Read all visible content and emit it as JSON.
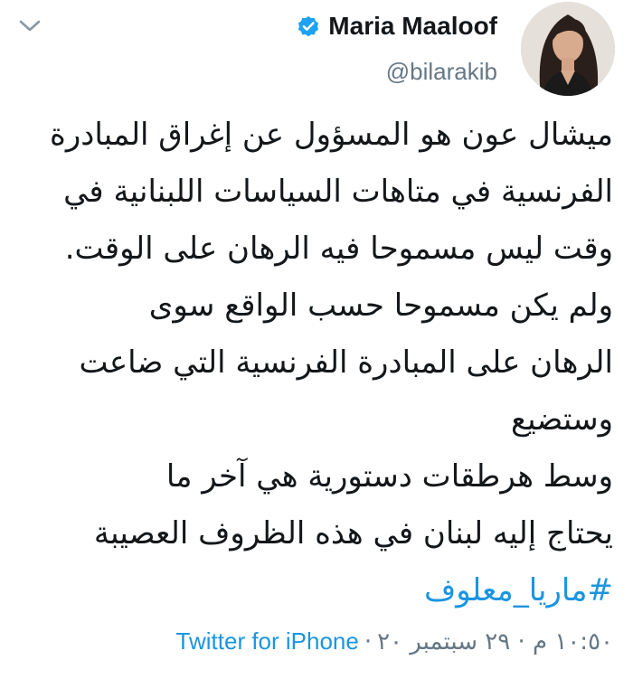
{
  "author": {
    "display_name": "Maria Maaloof",
    "handle": "@bilarakib",
    "verified": true
  },
  "tweet": {
    "lines": [
      "ميشال عون هو المسؤول عن إغراق المبادرة",
      "الفرنسية في متاهات السياسات اللبنانية في",
      "وقت ليس مسموحا فيه الرهان على الوقت.",
      "ولم يكن مسموحا  حسب الواقع سوى",
      "الرهان على المبادرة الفرنسية التي ضاعت",
      "وستضيع",
      "وسط هرطقات دستورية هي آخر ما",
      "يحتاج إليه لبنان في هذه الظروف العصيبة"
    ],
    "hashtag": "#ماريا_معلوف",
    "timestamp": "١٠:٥٠ م · ٢٩ سبتمبر ٢٠",
    "separator": "·",
    "source": "Twitter for iPhone"
  },
  "icons": {
    "menu": "chevron-down-icon",
    "verified": "verified-badge-icon"
  },
  "colors": {
    "text": "#14171a",
    "secondary": "#657786",
    "link": "#1b95e0",
    "verified": "#1da1f2"
  }
}
